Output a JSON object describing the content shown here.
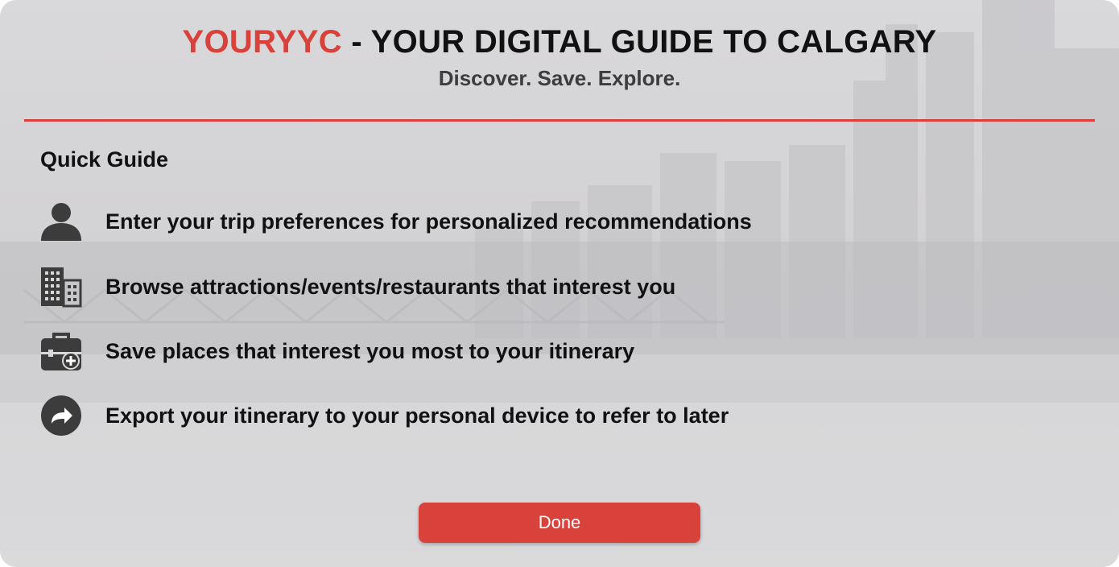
{
  "header": {
    "brand": "YOURYYC",
    "title_rest": " - YOUR DIGITAL GUIDE TO CALGARY",
    "subtitle": "Discover. Save. Explore."
  },
  "guide": {
    "heading": "Quick Guide",
    "steps": [
      {
        "icon": "person-icon",
        "text": "Enter your trip preferences for personalized recommendations"
      },
      {
        "icon": "building-icon",
        "text": "Browse attractions/events/restaurants that interest you"
      },
      {
        "icon": "briefcase-add-icon",
        "text": "Save places that interest you most to your itinerary"
      },
      {
        "icon": "share-arrow-icon",
        "text": "Export your itinerary to your personal device to refer to later"
      }
    ]
  },
  "actions": {
    "done_label": "Done"
  },
  "colors": {
    "accent": "#d9423a",
    "icon": "#3c3c3c",
    "text": "#111111"
  }
}
